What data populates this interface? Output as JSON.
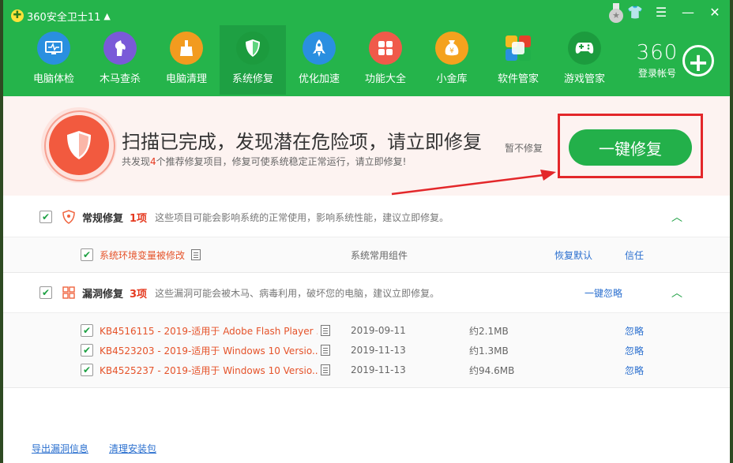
{
  "app": {
    "title": "360安全卫士11",
    "account_brand": "360",
    "account_label": "登录帐号"
  },
  "nav": [
    {
      "label": "电脑体检",
      "icon": "monitor-icon",
      "color": "#2a8fe0"
    },
    {
      "label": "木马查杀",
      "icon": "horse-icon",
      "color": "#7a5ad8"
    },
    {
      "label": "电脑清理",
      "icon": "broom-icon",
      "color": "#f29b1f"
    },
    {
      "label": "系统修复",
      "icon": "shield-icon",
      "color": "#1c9b3e"
    },
    {
      "label": "优化加速",
      "icon": "rocket-icon",
      "color": "#2a8fe0"
    },
    {
      "label": "功能大全",
      "icon": "grid-icon",
      "color": "#f05a4a"
    },
    {
      "label": "小金库",
      "icon": "money-bag-icon",
      "color": "#f4a21e"
    },
    {
      "label": "软件管家",
      "icon": "apps-icon",
      "color": "#ffffff"
    },
    {
      "label": "游戏管家",
      "icon": "gamepad-icon",
      "color": "#1c9b3e"
    }
  ],
  "banner": {
    "title": "扫描已完成，发现潜在危险项，请立即修复",
    "sub_prefix": "共发现",
    "sub_count": "4",
    "sub_suffix": "个推荐修复项目，修复可使系统稳定正常运行，请立即修复!",
    "dismiss": "暂不修复",
    "fix_button": "一键修复"
  },
  "sections": {
    "regular": {
      "title": "常规修复",
      "count": "1项",
      "desc": "这些项目可能会影响系统的正常使用，影响系统性能，建议立即修复。",
      "items": [
        {
          "name": "系统环境变量被修改",
          "category": "系统常用组件",
          "action1": "恢复默认",
          "action2": "信任"
        }
      ]
    },
    "vuln": {
      "title": "漏洞修复",
      "count": "3项",
      "desc": "这些漏洞可能会被木马、病毒利用，破坏您的电脑，建议立即修复。",
      "ignore_all": "一键忽略",
      "items": [
        {
          "name": "KB4516115 - 2019-适用于 Adobe Flash Player ...",
          "date": "2019-09-11",
          "size": "约2.1MB",
          "action": "忽略"
        },
        {
          "name": "KB4523203 - 2019-适用于 Windows 10 Versio...",
          "date": "2019-11-13",
          "size": "约1.3MB",
          "action": "忽略"
        },
        {
          "name": "KB4525237 - 2019-适用于 Windows 10 Versio...",
          "date": "2019-11-13",
          "size": "约94.6MB",
          "action": "忽略"
        }
      ]
    }
  },
  "footer": {
    "export": "导出漏洞信息",
    "cleanup": "清理安装包"
  },
  "colors": {
    "brand_green": "#25b44b",
    "danger_red": "#e53a20",
    "link_blue": "#2a6fcf"
  }
}
